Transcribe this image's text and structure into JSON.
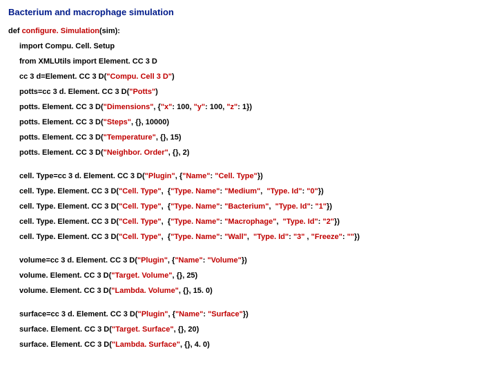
{
  "title": "Bacterium and macrophage simulation",
  "lines": [
    {
      "cls": "line",
      "frags": [
        {
          "t": "def ",
          "c": "blk"
        },
        {
          "t": "configure. Simulation",
          "c": "red"
        },
        {
          "t": "(sim):",
          "c": "blk"
        }
      ]
    },
    {
      "cls": "line ind1",
      "frags": [
        {
          "t": "import Compu. Cell. Setup",
          "c": "blk"
        }
      ]
    },
    {
      "cls": "line ind1",
      "frags": [
        {
          "t": "from XMLUtils import Element. CC 3 D",
          "c": "blk"
        }
      ]
    },
    {
      "cls": "line ind1",
      "frags": [
        {
          "t": "cc 3 d=Element. CC 3 D(",
          "c": "blk"
        },
        {
          "t": "\"Compu. Cell 3 D\"",
          "c": "red"
        },
        {
          "t": ")",
          "c": "blk"
        }
      ]
    },
    {
      "cls": "line ind1",
      "frags": [
        {
          "t": "potts=cc 3 d. Element. CC 3 D(",
          "c": "blk"
        },
        {
          "t": "\"Potts\"",
          "c": "red"
        },
        {
          "t": ")",
          "c": "blk"
        }
      ]
    },
    {
      "cls": "line ind1",
      "frags": [
        {
          "t": "potts. Element. CC 3 D(",
          "c": "blk"
        },
        {
          "t": "\"Dimensions\"",
          "c": "red"
        },
        {
          "t": ", {",
          "c": "blk"
        },
        {
          "t": "\"x\"",
          "c": "red"
        },
        {
          "t": ": 100, ",
          "c": "blk"
        },
        {
          "t": "\"y\"",
          "c": "red"
        },
        {
          "t": ": 100, ",
          "c": "blk"
        },
        {
          "t": "\"z\"",
          "c": "red"
        },
        {
          "t": ": 1})",
          "c": "blk"
        }
      ]
    },
    {
      "cls": "line ind1",
      "frags": [
        {
          "t": "potts. Element. CC 3 D(",
          "c": "blk"
        },
        {
          "t": "\"Steps\"",
          "c": "red"
        },
        {
          "t": ", {}, 10000)",
          "c": "blk"
        }
      ]
    },
    {
      "cls": "line ind1",
      "frags": [
        {
          "t": "potts. Element. CC 3 D(",
          "c": "blk"
        },
        {
          "t": "\"Temperature\"",
          "c": "red"
        },
        {
          "t": ", {}, 15)",
          "c": "blk"
        }
      ]
    },
    {
      "cls": "line ind1",
      "frags": [
        {
          "t": "potts. Element. CC 3 D(",
          "c": "blk"
        },
        {
          "t": "\"Neighbor. Order\"",
          "c": "red"
        },
        {
          "t": ", {}, 2)",
          "c": "blk"
        }
      ]
    },
    {
      "cls": "gap",
      "frags": []
    },
    {
      "cls": "line ind1",
      "frags": [
        {
          "t": "cell. Type=cc 3 d. Element. CC 3 D(",
          "c": "blk"
        },
        {
          "t": "\"Plugin\"",
          "c": "red"
        },
        {
          "t": ", {",
          "c": "blk"
        },
        {
          "t": "\"Name\"",
          "c": "red"
        },
        {
          "t": ": ",
          "c": "blk"
        },
        {
          "t": "\"Cell. Type\"",
          "c": "red"
        },
        {
          "t": "})",
          "c": "blk"
        }
      ]
    },
    {
      "cls": "line ind1",
      "frags": [
        {
          "t": "cell. Type. Element. CC 3 D(",
          "c": "blk"
        },
        {
          "t": "\"Cell. Type\"",
          "c": "red"
        },
        {
          "t": ",  {",
          "c": "blk"
        },
        {
          "t": "\"Type. Name\"",
          "c": "red"
        },
        {
          "t": ": ",
          "c": "blk"
        },
        {
          "t": "\"Medium\"",
          "c": "red"
        },
        {
          "t": ",  ",
          "c": "blk"
        },
        {
          "t": "\"Type. Id\"",
          "c": "red"
        },
        {
          "t": ": ",
          "c": "blk"
        },
        {
          "t": "\"0\"",
          "c": "red"
        },
        {
          "t": "})",
          "c": "blk"
        }
      ]
    },
    {
      "cls": "line ind1",
      "frags": [
        {
          "t": "cell. Type. Element. CC 3 D(",
          "c": "blk"
        },
        {
          "t": "\"Cell. Type\"",
          "c": "red"
        },
        {
          "t": ",  {",
          "c": "blk"
        },
        {
          "t": "\"Type. Name\"",
          "c": "red"
        },
        {
          "t": ": ",
          "c": "blk"
        },
        {
          "t": "\"Bacterium\"",
          "c": "red"
        },
        {
          "t": ",  ",
          "c": "blk"
        },
        {
          "t": "\"Type. Id\"",
          "c": "red"
        },
        {
          "t": ": ",
          "c": "blk"
        },
        {
          "t": "\"1\"",
          "c": "red"
        },
        {
          "t": "})",
          "c": "blk"
        }
      ]
    },
    {
      "cls": "line ind1",
      "frags": [
        {
          "t": "cell. Type. Element. CC 3 D(",
          "c": "blk"
        },
        {
          "t": "\"Cell. Type\"",
          "c": "red"
        },
        {
          "t": ",  {",
          "c": "blk"
        },
        {
          "t": "\"Type. Name\"",
          "c": "red"
        },
        {
          "t": ": ",
          "c": "blk"
        },
        {
          "t": "\"Macrophage\"",
          "c": "red"
        },
        {
          "t": ",  ",
          "c": "blk"
        },
        {
          "t": "\"Type. Id\"",
          "c": "red"
        },
        {
          "t": ": ",
          "c": "blk"
        },
        {
          "t": "\"2\"",
          "c": "red"
        },
        {
          "t": "})",
          "c": "blk"
        }
      ]
    },
    {
      "cls": "line ind1",
      "frags": [
        {
          "t": "cell. Type. Element. CC 3 D(",
          "c": "blk"
        },
        {
          "t": "\"Cell. Type\"",
          "c": "red"
        },
        {
          "t": ",  {",
          "c": "blk"
        },
        {
          "t": "\"Type. Name\"",
          "c": "red"
        },
        {
          "t": ": ",
          "c": "blk"
        },
        {
          "t": "\"Wall\"",
          "c": "red"
        },
        {
          "t": ",  ",
          "c": "blk"
        },
        {
          "t": "\"Type. Id\"",
          "c": "red"
        },
        {
          "t": ": ",
          "c": "blk"
        },
        {
          "t": "\"3\" ",
          "c": "red"
        },
        {
          "t": ", ",
          "c": "blk"
        },
        {
          "t": "\"Freeze\"",
          "c": "red"
        },
        {
          "t": ": ",
          "c": "blk"
        },
        {
          "t": "\"\"",
          "c": "red"
        },
        {
          "t": "})",
          "c": "blk"
        }
      ]
    },
    {
      "cls": "gap",
      "frags": []
    },
    {
      "cls": "line ind1",
      "frags": [
        {
          "t": "volume=cc 3 d. Element. CC 3 D(",
          "c": "blk"
        },
        {
          "t": "\"Plugin\"",
          "c": "red"
        },
        {
          "t": ", {",
          "c": "blk"
        },
        {
          "t": "\"Name\"",
          "c": "red"
        },
        {
          "t": ": ",
          "c": "blk"
        },
        {
          "t": "\"Volume\"",
          "c": "red"
        },
        {
          "t": "})",
          "c": "blk"
        }
      ]
    },
    {
      "cls": "line ind1",
      "frags": [
        {
          "t": "volume. Element. CC 3 D(",
          "c": "blk"
        },
        {
          "t": "\"Target. Volume\"",
          "c": "red"
        },
        {
          "t": ", {}, 25)",
          "c": "blk"
        }
      ]
    },
    {
      "cls": "line ind1",
      "frags": [
        {
          "t": "volume. Element. CC 3 D(",
          "c": "blk"
        },
        {
          "t": "\"Lambda. Volume\"",
          "c": "red"
        },
        {
          "t": ", {}, 15. 0)",
          "c": "blk"
        }
      ]
    },
    {
      "cls": "gap",
      "frags": []
    },
    {
      "cls": "line ind1",
      "frags": [
        {
          "t": "surface=cc 3 d. Element. CC 3 D(",
          "c": "blk"
        },
        {
          "t": "\"Plugin\"",
          "c": "red"
        },
        {
          "t": ", {",
          "c": "blk"
        },
        {
          "t": "\"Name\"",
          "c": "red"
        },
        {
          "t": ": ",
          "c": "blk"
        },
        {
          "t": "\"Surface\"",
          "c": "red"
        },
        {
          "t": "})",
          "c": "blk"
        }
      ]
    },
    {
      "cls": "line ind1",
      "frags": [
        {
          "t": "surface. Element. CC 3 D(",
          "c": "blk"
        },
        {
          "t": "\"Target. Surface\"",
          "c": "red"
        },
        {
          "t": ", {}, 20)",
          "c": "blk"
        }
      ]
    },
    {
      "cls": "line ind1",
      "frags": [
        {
          "t": "surface. Element. CC 3 D(",
          "c": "blk"
        },
        {
          "t": "\"Lambda. Surface\"",
          "c": "red"
        },
        {
          "t": ", {}, 4. 0)",
          "c": "blk"
        }
      ]
    }
  ]
}
